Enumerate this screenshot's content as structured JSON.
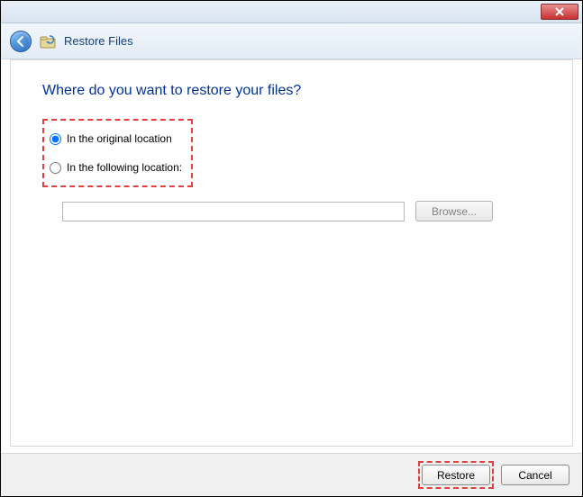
{
  "header": {
    "title": "Restore Files"
  },
  "content": {
    "heading": "Where do you want to restore your files?",
    "option_original": "In the original location",
    "option_following": "In the following location:",
    "location_value": "",
    "browse_label": "Browse..."
  },
  "footer": {
    "restore_label": "Restore",
    "cancel_label": "Cancel"
  },
  "state": {
    "selected_option": "original",
    "browse_enabled": false
  }
}
